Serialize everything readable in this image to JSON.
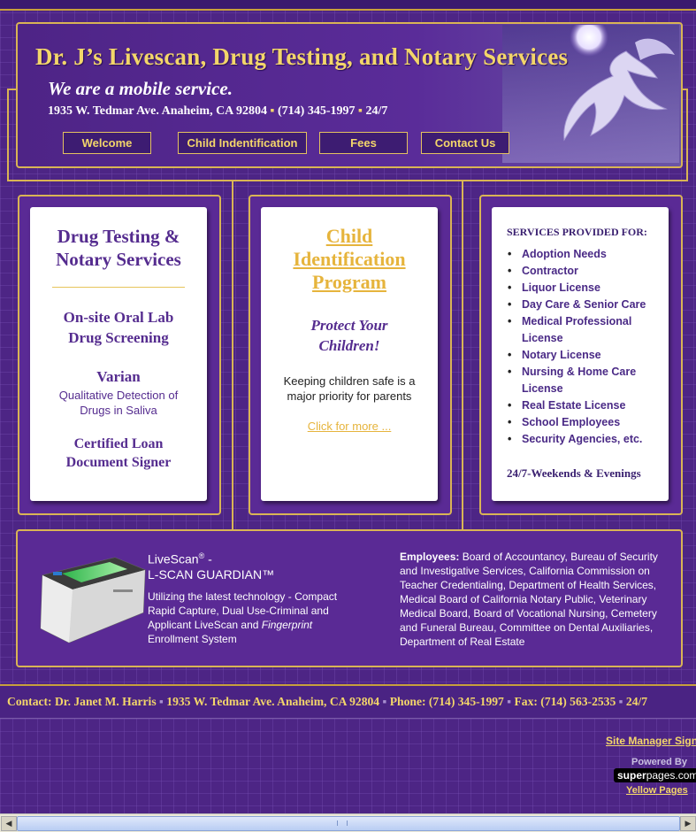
{
  "header": {
    "title": "Dr. J’s Livescan, Drug Testing, and Notary Services",
    "tagline": "We are a mobile service.",
    "address": "1935 W. Tedmar Ave. Anaheim, CA 92804",
    "phone": "(714) 345-1997",
    "hours": "24/7",
    "nav": [
      "Welcome",
      "Child Indentification",
      "Fees",
      "Contact Us"
    ]
  },
  "col1": {
    "title": "Drug Testing & Notary Services",
    "oral_lab": "On-site Oral Lab Drug Screening",
    "varian": "Varian",
    "varian_desc": "Qualitative Detection of Drugs in Saliva",
    "loan": "Certified Loan Document Signer"
  },
  "col2": {
    "title": "Child Identification Program",
    "protect": "Protect Your Children!",
    "text": "Keeping children safe is a major priority for parents",
    "link": "Click for more ..."
  },
  "col3": {
    "heading": "SERVICES PROVIDED FOR:",
    "items": [
      "Adoption Needs",
      "Contractor",
      "Liquor License",
      "Day Care & Senior Care",
      "Medical Professional License",
      "Notary License",
      "Nursing & Home Care License",
      "Real Estate License",
      "School Employees",
      "Security Agencies, etc."
    ],
    "footer": "24/7-Weekends & Evenings"
  },
  "livescan": {
    "title_line1": "LiveScan",
    "reg": "®",
    "dash": "-",
    "title_line2": "L-SCAN GUARDIAN™",
    "desc_before": "Utilizing the latest technology - Compact Rapid Capture, Dual Use-Criminal and Applicant LiveScan and ",
    "desc_italic": "Fingerprint",
    "desc_after": " Enrollment System",
    "employees_label": "Employees:",
    "employees_text": " Board of Accountancy, Bureau of Security and Investigative Services, California Commission on Teacher Credentialing, Department of Health Services, Medical Board of California Notary Public, Veterinary Medical Board, Board of Vocational Nursing, Cemetery and Funeral Bureau, Committee on Dental Auxiliaries, Department of Real Estate"
  },
  "footer": {
    "contact": "Contact: Dr. Janet M. Harris",
    "address": "1935 W. Tedmar Ave. Anaheim, CA 92804",
    "phone": "Phone: (714) 345-1997",
    "fax": "Fax: (714) 563-2535",
    "hours": "24/7",
    "site_manager": "Site Manager Sign",
    "powered_by": "Powered By",
    "brand_super": "super",
    "brand_pages": "pages.com",
    "yellow_pages": "Yellow Pages"
  },
  "colors": {
    "accent": "#f3d66a",
    "background": "#4d2585",
    "text_purple": "#552c8f"
  }
}
